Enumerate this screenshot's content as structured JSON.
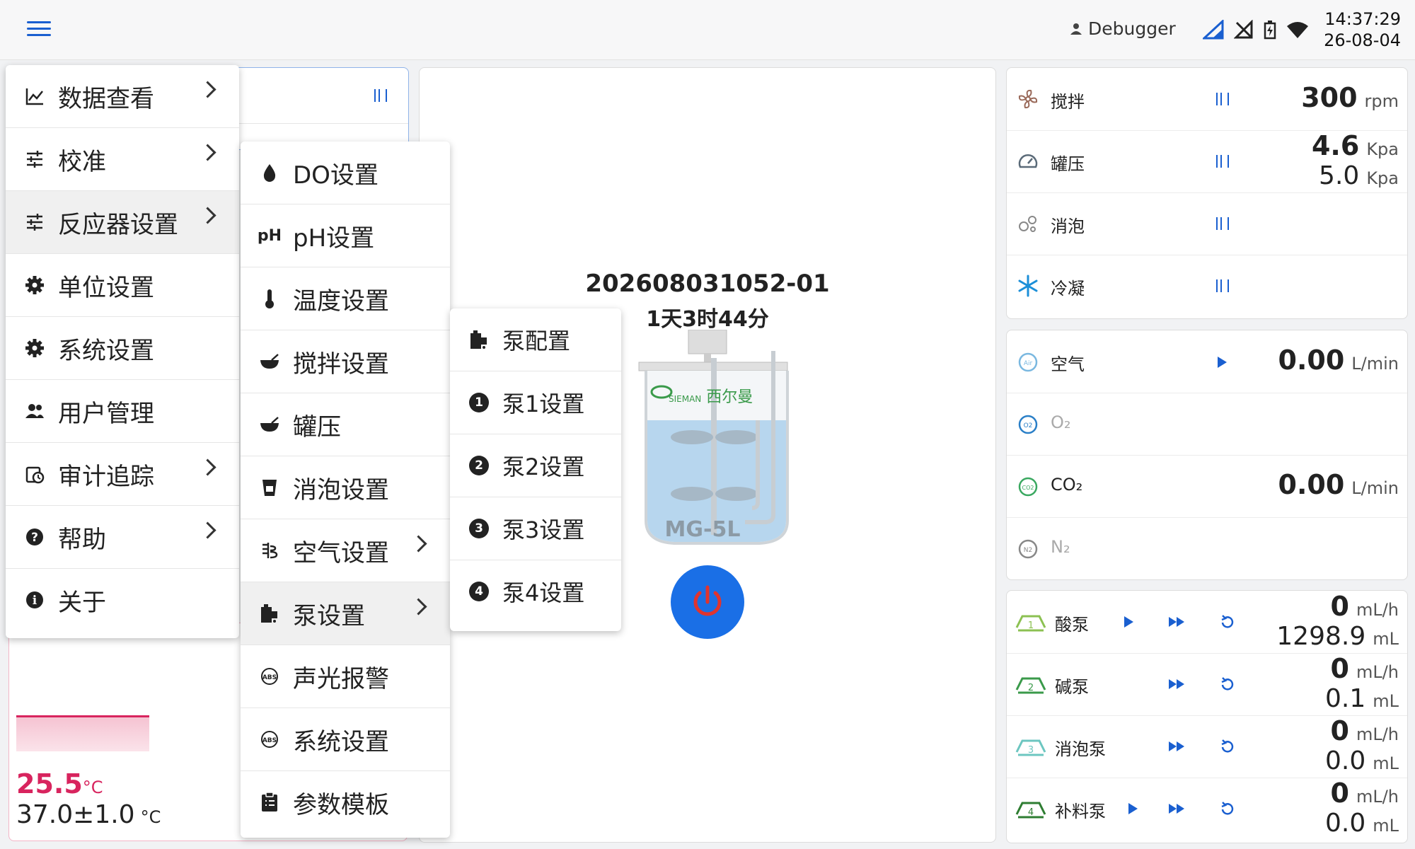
{
  "header": {
    "username": "Debugger",
    "time": "14:37:29",
    "date": "26-08-04"
  },
  "center": {
    "batch_id": "202608031052-01",
    "duration": "1天3时44分",
    "vessel_label": "MG-5L",
    "brand_cn": "西尔曼",
    "brand_en": "SIEMAN"
  },
  "left_card": {
    "temp_current": "25.5",
    "temp_unit": "°C",
    "temp_setpoint": "37.0±1.0",
    "setpoint_unit": "°C"
  },
  "main_menu": {
    "items": [
      {
        "label": "数据查看",
        "icon": "chart-line-icon",
        "has_submenu": true
      },
      {
        "label": "校准",
        "icon": "tune-icon",
        "has_submenu": true
      },
      {
        "label": "反应器设置",
        "icon": "tune-icon",
        "has_submenu": true,
        "active": true
      },
      {
        "label": "单位设置",
        "icon": "gear-icon",
        "has_submenu": false
      },
      {
        "label": "系统设置",
        "icon": "gear-icon",
        "has_submenu": false
      },
      {
        "label": "用户管理",
        "icon": "users-icon",
        "has_submenu": false
      },
      {
        "label": "审计追踪",
        "icon": "history-icon",
        "has_submenu": true
      },
      {
        "label": "帮助",
        "icon": "help-icon",
        "has_submenu": true
      },
      {
        "label": "关于",
        "icon": "info-icon",
        "has_submenu": false
      }
    ]
  },
  "reactor_menu": {
    "items": [
      {
        "label": "DO设置",
        "icon": "drop-icon"
      },
      {
        "label": "pH设置",
        "icon": "ph-icon"
      },
      {
        "label": "温度设置",
        "icon": "thermometer-icon"
      },
      {
        "label": "搅拌设置",
        "icon": "bowl-icon"
      },
      {
        "label": "罐压",
        "icon": "bowl-icon"
      },
      {
        "label": "消泡设置",
        "icon": "cup-icon"
      },
      {
        "label": "空气设置",
        "icon": "air-icon",
        "has_submenu": true
      },
      {
        "label": "泵设置",
        "icon": "pump-icon",
        "has_submenu": true,
        "active": true
      },
      {
        "label": "声光报警",
        "icon": "abs-icon"
      },
      {
        "label": "系统设置",
        "icon": "abs-icon"
      },
      {
        "label": "参数模板",
        "icon": "clipboard-icon"
      }
    ]
  },
  "pump_menu": {
    "items": [
      {
        "label": "泵配置",
        "badge": ""
      },
      {
        "label": "泵1设置",
        "badge": "1"
      },
      {
        "label": "泵2设置",
        "badge": "2"
      },
      {
        "label": "泵3设置",
        "badge": "3"
      },
      {
        "label": "泵4设置",
        "badge": "4"
      }
    ]
  },
  "control_panel": {
    "stir": {
      "label": "搅拌",
      "value": "300",
      "unit": "rpm"
    },
    "pressure": {
      "label": "罐压",
      "value": "4.6",
      "unit": "Kpa",
      "setpoint": "5.0",
      "setpoint_unit": "Kpa"
    },
    "antifoam": {
      "label": "消泡"
    },
    "condense": {
      "label": "冷凝"
    }
  },
  "gas_panel": {
    "air": {
      "label": "空气",
      "value": "0.00",
      "unit": "L/min",
      "badge": "Air"
    },
    "o2": {
      "label": "O₂",
      "badge": "O2"
    },
    "co2": {
      "label": "CO₂",
      "value": "0.00",
      "unit": "L/min",
      "badge": "CO2"
    },
    "n2": {
      "label": "N₂",
      "badge": "N2"
    }
  },
  "pump_panel": {
    "pumps": [
      {
        "label": "酸泵",
        "num": "1",
        "rate": "0",
        "rate_unit": "mL/h",
        "total": "1298.9",
        "total_unit": "mL",
        "color": "#8cc152"
      },
      {
        "label": "碱泵",
        "num": "2",
        "rate": "0",
        "rate_unit": "mL/h",
        "total": "0.1",
        "total_unit": "mL",
        "color": "#3a9a4a"
      },
      {
        "label": "消泡泵",
        "num": "3",
        "rate": "0",
        "rate_unit": "mL/h",
        "total": "0.0",
        "total_unit": "mL",
        "color": "#6cc6c0"
      },
      {
        "label": "补料泵",
        "num": "4",
        "rate": "0",
        "rate_unit": "mL/h",
        "total": "0.0",
        "total_unit": "mL",
        "color": "#2e7d32"
      }
    ]
  },
  "colors": {
    "accent": "#1a5fd0",
    "power_button": "#1a6fe6",
    "power_icon": "#e0342e",
    "temp_text": "#d8245e"
  }
}
